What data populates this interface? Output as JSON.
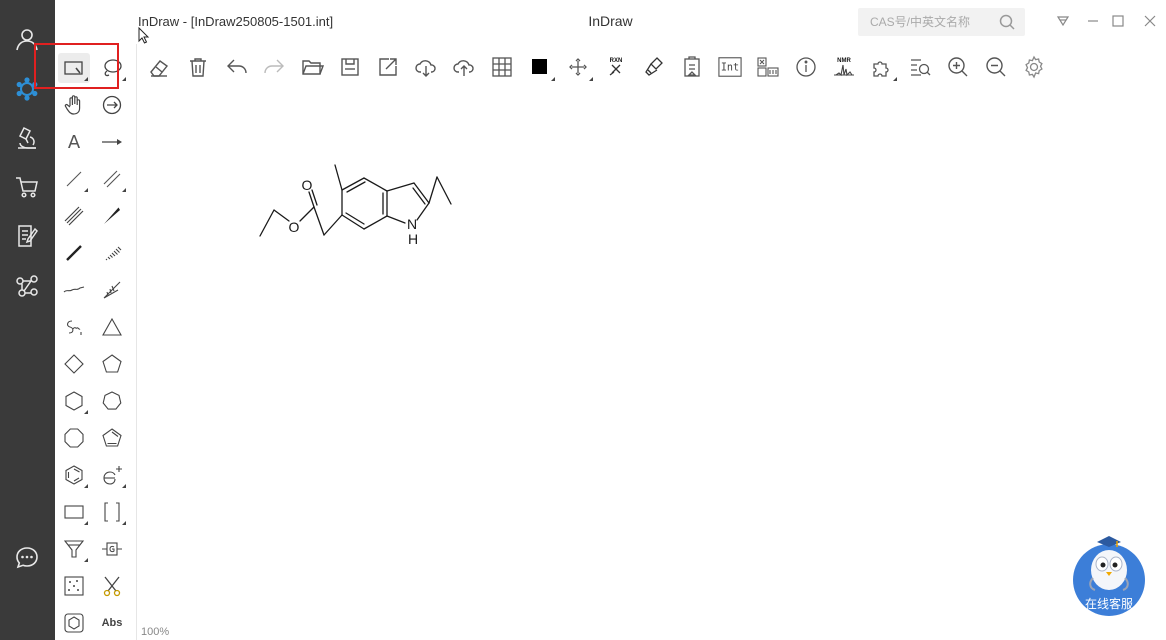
{
  "window": {
    "doc_title": "InDraw - [InDraw250805-1501.int]",
    "app_title": "InDraw"
  },
  "search": {
    "placeholder": "CAS号/中英文名称"
  },
  "rail": [
    "user-icon",
    "structure-icon",
    "microscope-icon",
    "cart-icon",
    "notes-icon",
    "network-icon",
    "chat-icon"
  ],
  "toolbar": [
    "eraser",
    "delete",
    "undo",
    "redo",
    "open",
    "save",
    "export",
    "cloud-download",
    "cloud-upload",
    "grid",
    "color",
    "cleanup",
    "reaction",
    "clean-brush",
    "clipboard",
    "int",
    "structure-name",
    "info",
    "nmr",
    "puzzle",
    "search-zoom",
    "zoom-in",
    "zoom-out",
    "settings"
  ],
  "toolbar_text": {
    "reaction": "RXN",
    "nmr": "NMR",
    "int": "Int"
  },
  "palette_text": {
    "text_tool": "A",
    "abs_tool": "Abs"
  },
  "molecule": {
    "atom_O_carbonyl": "O",
    "atom_O_ester": "O",
    "atom_N": "N",
    "atom_H": "H"
  },
  "status": {
    "zoom": "100%"
  },
  "mascot": {
    "label": "在线客服"
  },
  "colors": {
    "rail_bg": "#3a3a3a",
    "highlight": "#e02020",
    "accent": "#2d8fd6",
    "mascot": "#3c7ed8"
  }
}
